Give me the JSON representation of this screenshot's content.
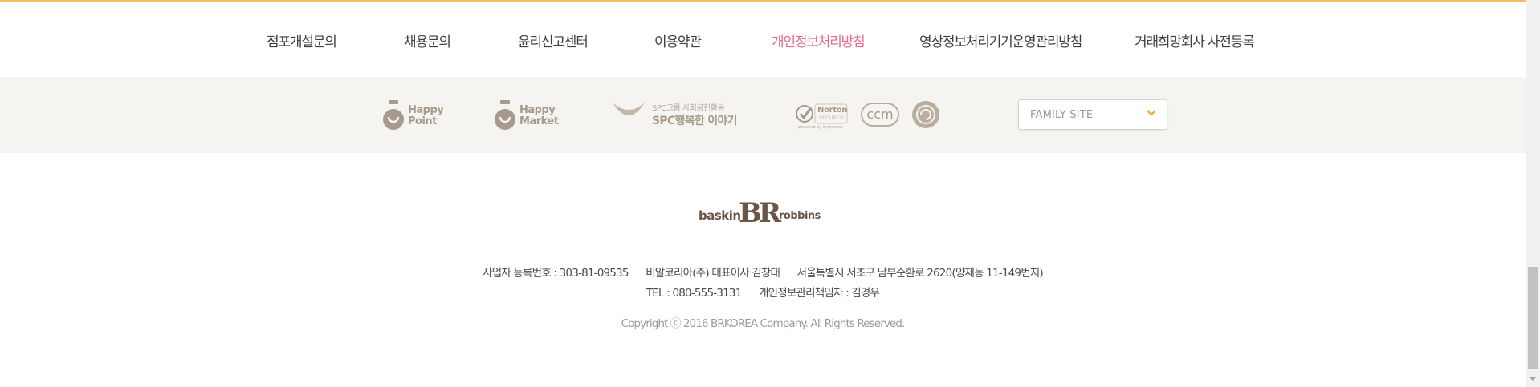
{
  "footer_nav": {
    "items": [
      {
        "label": "점포개설문의"
      },
      {
        "label": "채용문의"
      },
      {
        "label": "윤리신고센터"
      },
      {
        "label": "이용약관"
      },
      {
        "label": "개인정보처리방침"
      },
      {
        "label": "영상정보처리기기운영관리방침"
      },
      {
        "label": "거래희망회사 사전등록"
      }
    ],
    "active_color": "#e86b8c"
  },
  "partners": {
    "happy_point": {
      "line1": "Happy",
      "line2": "Point"
    },
    "happy_market": {
      "line1": "Happy",
      "line2": "Market"
    },
    "spc_story": {
      "line1": "SPC그룹 사회공헌활동",
      "line2": "SPC행복한 이야기"
    },
    "norton": {
      "line1": "Norton",
      "line2": "SECURED",
      "line3": "powered by Symantec"
    },
    "ccm": {
      "label": "ccm"
    }
  },
  "family_site": {
    "value": "FAMILY SITE"
  },
  "company": {
    "logo_left": "baskin",
    "logo_mid": "BR",
    "logo_right": "robbins",
    "biz_number": "사업자 등록번호 : 303-81-09535",
    "company_ceo": "비알코리아(주) 대표이사 김창대",
    "address": "서울특별시 서초구 남부순환로 2620(양재동 11-149번지)",
    "tel": "TEL : 080-555-3131",
    "privacy_officer": "개인정보관리책임자 : 김경우",
    "copyright": "Copyright ⓒ 2016 BRKOREA Company. All Rights Reserved."
  },
  "colors": {
    "accent_line": "#f0c35a",
    "band_bg": "#f6f4f1",
    "partner_gray": "#a59a8b"
  }
}
